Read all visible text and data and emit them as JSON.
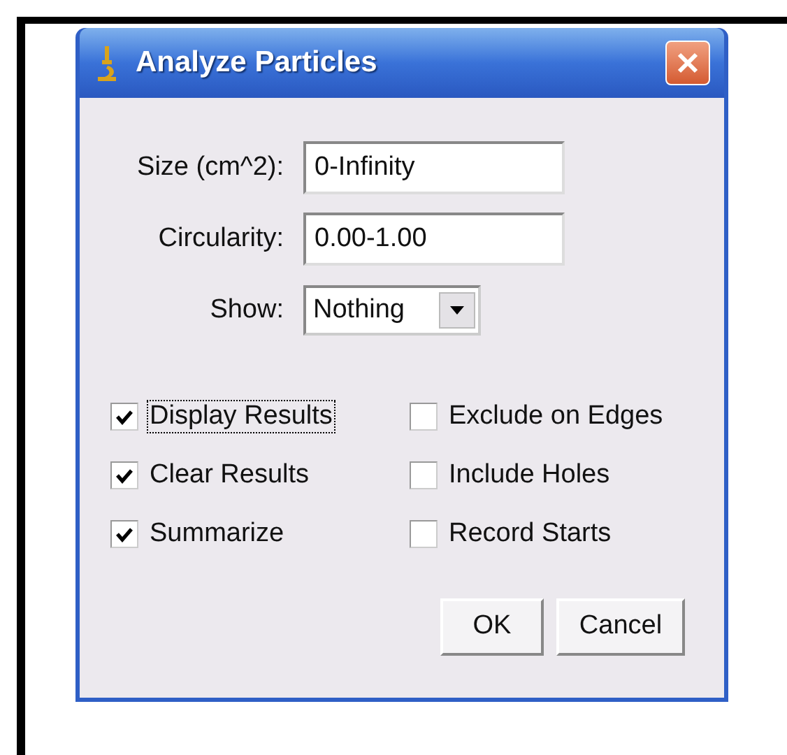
{
  "window": {
    "title": "Analyze Particles"
  },
  "fields": [
    {
      "label": "Size (cm^2):",
      "value": "0-Infinity"
    },
    {
      "label": "Circularity:",
      "value": "0.00-1.00"
    }
  ],
  "show": {
    "label": "Show:",
    "value": "Nothing"
  },
  "options": [
    {
      "label": "Display Results",
      "checked": true,
      "focused": true
    },
    {
      "label": "Exclude on Edges",
      "checked": false,
      "focused": false
    },
    {
      "label": "Clear Results",
      "checked": true,
      "focused": false
    },
    {
      "label": "Include Holes",
      "checked": false,
      "focused": false
    },
    {
      "label": "Summarize",
      "checked": true,
      "focused": false
    },
    {
      "label": "Record Starts",
      "checked": false,
      "focused": false
    }
  ],
  "buttons": [
    "OK",
    "Cancel"
  ]
}
